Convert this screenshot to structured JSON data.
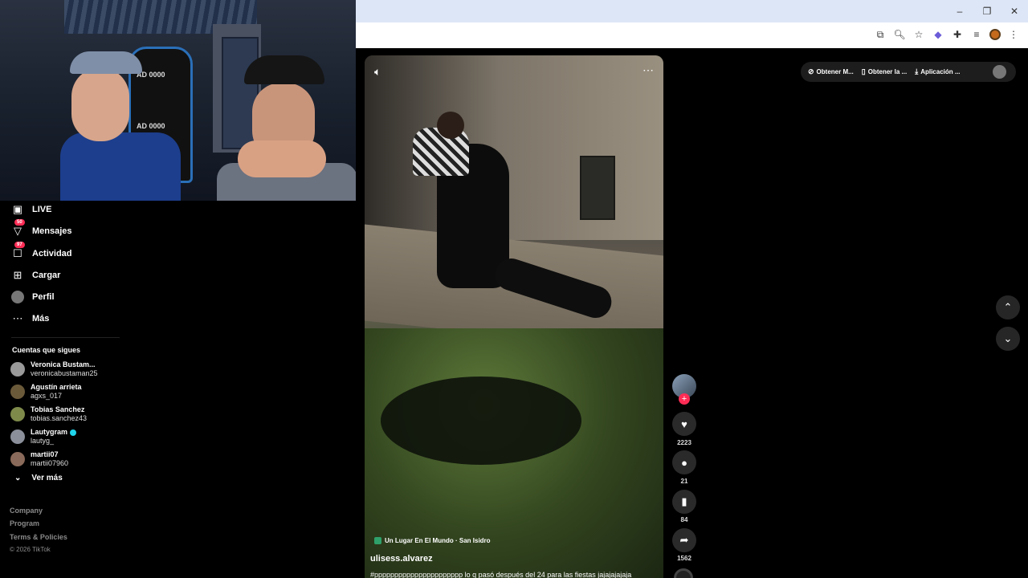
{
  "sidebar": {
    "items": [
      {
        "label": "LIVE",
        "icon": "live-icon",
        "badge": ""
      },
      {
        "label": "Mensajes",
        "icon": "messages-icon",
        "badge": "50"
      },
      {
        "label": "Actividad",
        "icon": "activity-icon",
        "badge": "97"
      },
      {
        "label": "Cargar",
        "icon": "upload-icon",
        "badge": ""
      },
      {
        "label": "Perfil",
        "icon": "profile-avatar",
        "badge": ""
      },
      {
        "label": "Más",
        "icon": "more-icon",
        "badge": ""
      }
    ],
    "following_title": "Cuentas que sigues",
    "accounts": [
      {
        "name": "Veronica Bustam...",
        "username": "veronicabustaman25",
        "verified": false
      },
      {
        "name": "Agustín arrieta",
        "username": "agxs_017",
        "verified": false
      },
      {
        "name": "Tobias Sanchez",
        "username": "tobias.sanchez43",
        "verified": false
      },
      {
        "name": "Lautygram",
        "username": "lautyg_",
        "verified": true
      },
      {
        "name": "martii07",
        "username": "martii07960",
        "verified": false
      }
    ],
    "see_more": "Ver más",
    "footer": [
      "Company",
      "Program",
      "Terms & Policies"
    ],
    "copyright": "© 2026 TikTok"
  },
  "webcam": {
    "chair_text_1": "AD 0000",
    "chair_text_2": "AD 0000"
  },
  "video": {
    "location": "Un Lugar En El Mundo · San Isidro",
    "author": "ulisess.alvarez",
    "caption": "#pppppppppppppppppppppp lo q pasó después del 24 para las fiestas jajajajajaja",
    "actions": {
      "likes": "2223",
      "comments": "21",
      "saves": "84",
      "shares": "1562"
    }
  },
  "top_bar": {
    "items": [
      {
        "label": "Obtener M...",
        "icon": "coin-icon"
      },
      {
        "label": "Obtener la ...",
        "icon": "phone-icon"
      },
      {
        "label": "Aplicación ...",
        "icon": "download-icon"
      }
    ]
  },
  "colors": {
    "accent": "#fe2c55",
    "background": "#000000",
    "verified": "#20d5ec"
  }
}
